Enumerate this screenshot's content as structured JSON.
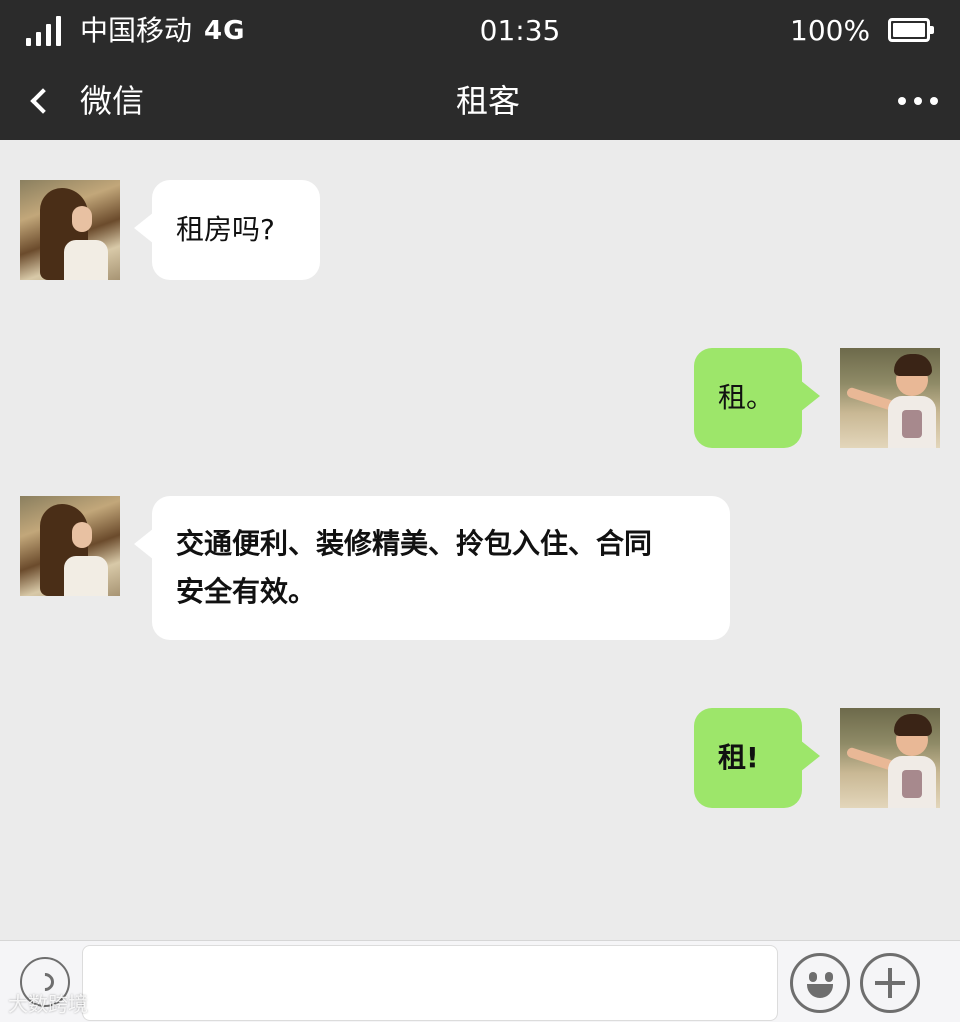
{
  "status_bar": {
    "carrier": "中国移动",
    "network": "4G",
    "time": "01:35",
    "battery_percent": "100%"
  },
  "nav": {
    "back_label": "微信",
    "title": "租客"
  },
  "messages": [
    {
      "side": "left",
      "sender": "contact",
      "text": "租房吗?"
    },
    {
      "side": "right",
      "sender": "me",
      "text": "租。"
    },
    {
      "side": "left",
      "sender": "contact",
      "bold": true,
      "lines": [
        "交通便利、装修精美、拎包入住、合同",
        "安全有效。"
      ]
    },
    {
      "side": "right",
      "sender": "me",
      "bold": true,
      "text": "租!"
    }
  ],
  "input_bar": {
    "voice_icon": "voice-icon",
    "emoji_icon": "emoji-icon",
    "plus_icon": "plus-icon",
    "input_value": ""
  },
  "watermark": "大数跨境",
  "colors": {
    "header_bg": "#2b2b2b",
    "chat_bg": "#ebebeb",
    "my_bubble": "#9de66a",
    "their_bubble": "#ffffff"
  }
}
